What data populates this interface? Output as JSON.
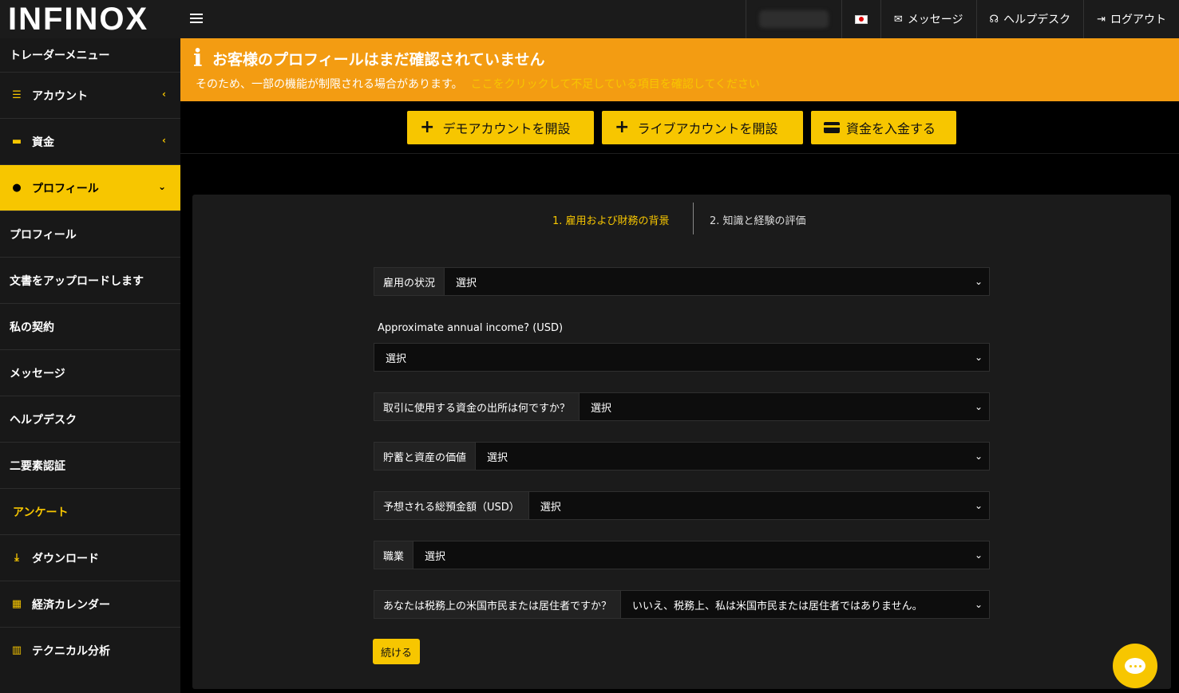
{
  "header": {
    "logo": "INFINOX",
    "nav": {
      "messages": "メッセージ",
      "helpdesk": "ヘルプデスク",
      "logout": "ログアウト"
    }
  },
  "sidebar": {
    "title": "トレーダーメニュー",
    "items": [
      {
        "label": "アカウント"
      },
      {
        "label": "資金"
      },
      {
        "label": "プロフィール"
      },
      {
        "label": "プロフィール"
      },
      {
        "label": "文書をアップロードします"
      },
      {
        "label": "私の契約"
      },
      {
        "label": "メッセージ"
      },
      {
        "label": "ヘルプデスク"
      },
      {
        "label": "二要素認証"
      },
      {
        "label": "アンケート"
      },
      {
        "label": "ダウンロード"
      },
      {
        "label": "経済カレンダー"
      },
      {
        "label": "テクニカル分析"
      }
    ]
  },
  "banner": {
    "title": "お客様のプロフィールはまだ確認されていません",
    "subtitle": "そのため、一部の機能が制限される場合があります。",
    "link": "ここをクリックして不足している項目を確認してください"
  },
  "actions": {
    "demo": "デモアカウントを開設",
    "live": "ライブアカウントを開設",
    "deposit": "資金を入金する"
  },
  "steps": {
    "step1": "1. 雇用および財務の背景",
    "step2": "2. 知識と経験の評価"
  },
  "form": {
    "employment": {
      "label": "雇用の状況",
      "value": "選択"
    },
    "income": {
      "label": "Approximate annual income? (USD)",
      "value": "選択"
    },
    "source": {
      "label": "取引に使用する資金の出所は何ですか？",
      "value": "選択"
    },
    "savings": {
      "label": "貯蓄と資産の価値",
      "value": "選択"
    },
    "deposit": {
      "label": "予想される総預金額（USD）",
      "value": "選択"
    },
    "occupation": {
      "label": "職業",
      "value": "選択"
    },
    "us_tax": {
      "label": "あなたは税務上の米国市民または居住者ですか？",
      "value": "いいえ、税務上、私は米国市民または居住者ではありません。"
    },
    "continue": "続ける"
  }
}
